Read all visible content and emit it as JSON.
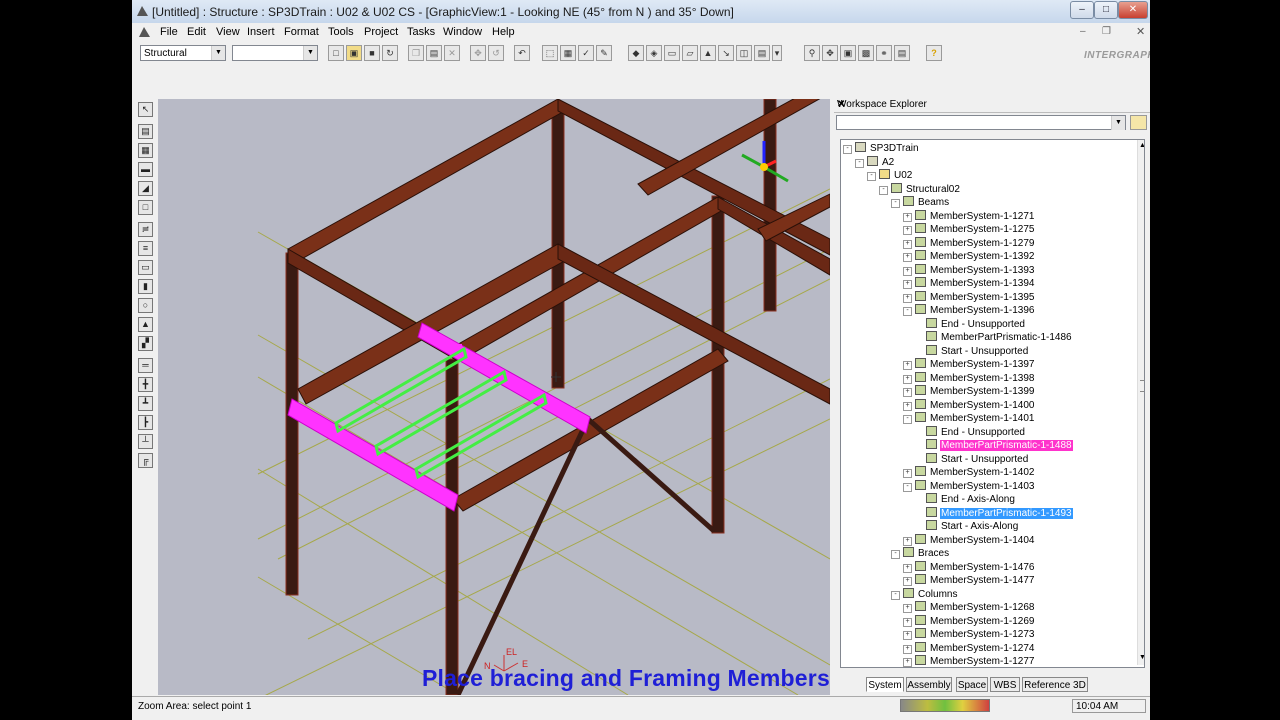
{
  "window": {
    "title": "[Untitled] : Structure : SP3DTrain : U02 & U02 CS - [GraphicView:1 - Looking NE (45° from N ) and 35° Down]"
  },
  "menubar": [
    "File",
    "Edit",
    "View",
    "Insert",
    "Format",
    "Tools",
    "Project",
    "Tasks",
    "Window",
    "Help"
  ],
  "toolbar": {
    "task_combo": "Structural",
    "filter_combo": "",
    "logo": "INTERGRAPH"
  },
  "graphic_view": {
    "axis_labels": {
      "n": "N",
      "el": "EL",
      "e": "E"
    }
  },
  "workspace_explorer": {
    "title": "Workspace Explorer",
    "combo": "",
    "tree": [
      {
        "label": "SP3DTrain",
        "level": 0,
        "exp": "-"
      },
      {
        "label": "A2",
        "level": 1,
        "exp": "-"
      },
      {
        "label": "U02",
        "level": 2,
        "exp": "-"
      },
      {
        "label": "Structural02",
        "level": 3,
        "exp": "-"
      },
      {
        "label": "Beams",
        "level": 4,
        "exp": "-"
      },
      {
        "label": "MemberSystem-1-1271",
        "level": 5,
        "exp": "+"
      },
      {
        "label": "MemberSystem-1-1275",
        "level": 5,
        "exp": "+"
      },
      {
        "label": "MemberSystem-1-1279",
        "level": 5,
        "exp": "+"
      },
      {
        "label": "MemberSystem-1-1392",
        "level": 5,
        "exp": "+"
      },
      {
        "label": "MemberSystem-1-1393",
        "level": 5,
        "exp": "+"
      },
      {
        "label": "MemberSystem-1-1394",
        "level": 5,
        "exp": "+"
      },
      {
        "label": "MemberSystem-1-1395",
        "level": 5,
        "exp": "+"
      },
      {
        "label": "MemberSystem-1-1396",
        "level": 5,
        "exp": "-"
      },
      {
        "label": "End - Unsupported",
        "level": 6,
        "exp": ""
      },
      {
        "label": "MemberPartPrismatic-1-1486",
        "level": 6,
        "exp": ""
      },
      {
        "label": "Start - Unsupported",
        "level": 6,
        "exp": ""
      },
      {
        "label": "MemberSystem-1-1397",
        "level": 5,
        "exp": "+"
      },
      {
        "label": "MemberSystem-1-1398",
        "level": 5,
        "exp": "+"
      },
      {
        "label": "MemberSystem-1-1399",
        "level": 5,
        "exp": "+"
      },
      {
        "label": "MemberSystem-1-1400",
        "level": 5,
        "exp": "+"
      },
      {
        "label": "MemberSystem-1-1401",
        "level": 5,
        "exp": "-"
      },
      {
        "label": "End - Unsupported",
        "level": 6,
        "exp": ""
      },
      {
        "label": "MemberPartPrismatic-1-1488",
        "level": 6,
        "exp": "",
        "sel": "m"
      },
      {
        "label": "Start - Unsupported",
        "level": 6,
        "exp": ""
      },
      {
        "label": "MemberSystem-1-1402",
        "level": 5,
        "exp": "+"
      },
      {
        "label": "MemberSystem-1-1403",
        "level": 5,
        "exp": "-"
      },
      {
        "label": "End - Axis-Along",
        "level": 6,
        "exp": ""
      },
      {
        "label": "MemberPartPrismatic-1-1493",
        "level": 6,
        "exp": "",
        "sel": "b"
      },
      {
        "label": "Start - Axis-Along",
        "level": 6,
        "exp": ""
      },
      {
        "label": "MemberSystem-1-1404",
        "level": 5,
        "exp": "+"
      },
      {
        "label": "Braces",
        "level": 4,
        "exp": "-"
      },
      {
        "label": "MemberSystem-1-1476",
        "level": 5,
        "exp": "+"
      },
      {
        "label": "MemberSystem-1-1477",
        "level": 5,
        "exp": "+"
      },
      {
        "label": "Columns",
        "level": 4,
        "exp": "-"
      },
      {
        "label": "MemberSystem-1-1268",
        "level": 5,
        "exp": "+"
      },
      {
        "label": "MemberSystem-1-1269",
        "level": 5,
        "exp": "+"
      },
      {
        "label": "MemberSystem-1-1273",
        "level": 5,
        "exp": "+"
      },
      {
        "label": "MemberSystem-1-1274",
        "level": 5,
        "exp": "+"
      },
      {
        "label": "MemberSystem-1-1277",
        "level": 5,
        "exp": "+"
      }
    ],
    "tabs": [
      "System",
      "Assembly",
      "Space",
      "WBS",
      "Reference 3D"
    ]
  },
  "status": {
    "message": "Zoom Area: select point 1",
    "clock": "10:04 AM"
  },
  "caption": "Place bracing and Framing Members"
}
